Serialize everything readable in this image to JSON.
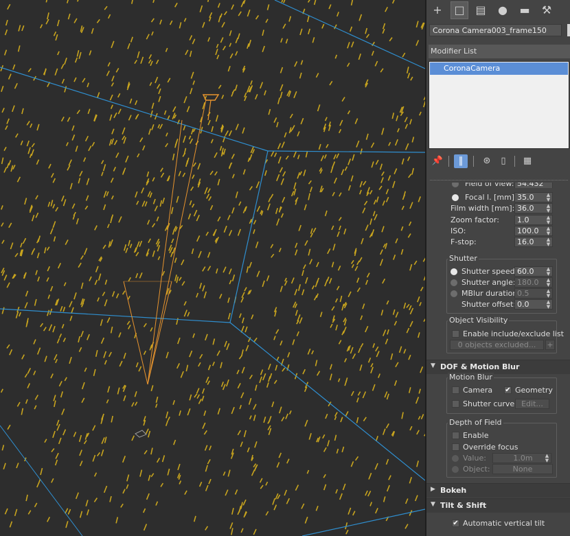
{
  "viewport": {
    "colors": {
      "background": "#2d2d2d",
      "scatter": "#c9a51e",
      "camera": "#e8942e",
      "grid": "#2f8fd0"
    }
  },
  "command_panel": {
    "tabs": [
      {
        "icon": "create-plus-icon"
      },
      {
        "icon": "modify-icon"
      },
      {
        "icon": "hierarchy-icon"
      },
      {
        "icon": "motion-icon"
      },
      {
        "icon": "display-icon"
      },
      {
        "icon": "utilities-wrench-icon"
      }
    ],
    "object_name": "Corona Camera003_frame150",
    "modifier_list_label": "Modifier List",
    "modifier_stack": [
      "CoronaCamera"
    ],
    "stack_tools": [
      "pin-stack-icon",
      "show-end-result-icon",
      "make-unique-icon",
      "remove-modifier-icon",
      "configure-modifier-sets-icon"
    ]
  },
  "camera": {
    "field_of_view_label": "Field of view:",
    "field_of_view_value": "54.432",
    "focal_label": "Focal l. [mm]:",
    "focal_value": "35.0",
    "film_width_label": "Film width [mm]:",
    "film_width_value": "36.0",
    "zoom_label": "Zoom factor:",
    "zoom_value": "1.0",
    "iso_label": "ISO:",
    "iso_value": "100.0",
    "fstop_label": "F-stop:",
    "fstop_value": "16.0"
  },
  "shutter": {
    "title": "Shutter",
    "speed_label": "Shutter speed:",
    "speed_value": "60.0",
    "angle_label": "Shutter angle:",
    "angle_value": "180.0",
    "mblur_label": "MBlur duration:",
    "mblur_value": "0.5",
    "offset_label": "Shutter offset:",
    "offset_value": "0.0"
  },
  "object_visibility": {
    "title": "Object Visibility",
    "enable_label": "Enable include/exclude list",
    "excluded_text": "0 objects excluded...",
    "plus": "+"
  },
  "dof_rollout": {
    "title": "DOF & Motion Blur",
    "motion_blur_title": "Motion Blur",
    "camera_label": "Camera",
    "geometry_label": "Geometry",
    "shutter_curve_label": "Shutter curve:",
    "edit_button": "Edit...",
    "dof_title": "Depth of Field",
    "enable_label": "Enable",
    "override_label": "Override focus",
    "value_label": "Value:",
    "value_value": "1.0m",
    "object_label": "Object:",
    "object_value": "None"
  },
  "bokeh_rollout": {
    "title": "Bokeh"
  },
  "tilt_rollout": {
    "title": "Tilt & Shift",
    "auto_label": "Automatic vertical tilt"
  }
}
